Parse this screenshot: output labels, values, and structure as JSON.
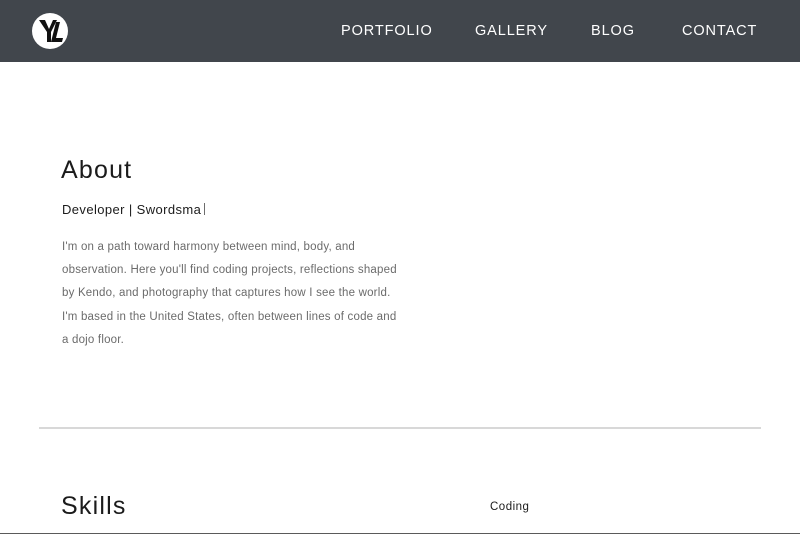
{
  "nav": {
    "logo_text": "YL",
    "links": [
      {
        "label": "PORTFOLIO"
      },
      {
        "label": "GALLERY"
      },
      {
        "label": "BLOG"
      },
      {
        "label": "CONTACT"
      }
    ]
  },
  "about": {
    "title": "About",
    "typed_text": "Developer | Swordsma",
    "body_lines": [
      "I'm on a path toward harmony between mind, body, and",
      "observation. Here you'll find coding projects, reflections shaped",
      "by Kendo, and photography that captures how I see the world.",
      "I'm based in the United States, often between lines of code and",
      "a dojo floor."
    ]
  },
  "skills": {
    "title": "Skills",
    "category_label": "Coding"
  },
  "colors": {
    "navbar": "#41464c",
    "heading": "#1b1b1b",
    "body_text": "#6b6b6b",
    "divider": "#d8d8d8"
  }
}
